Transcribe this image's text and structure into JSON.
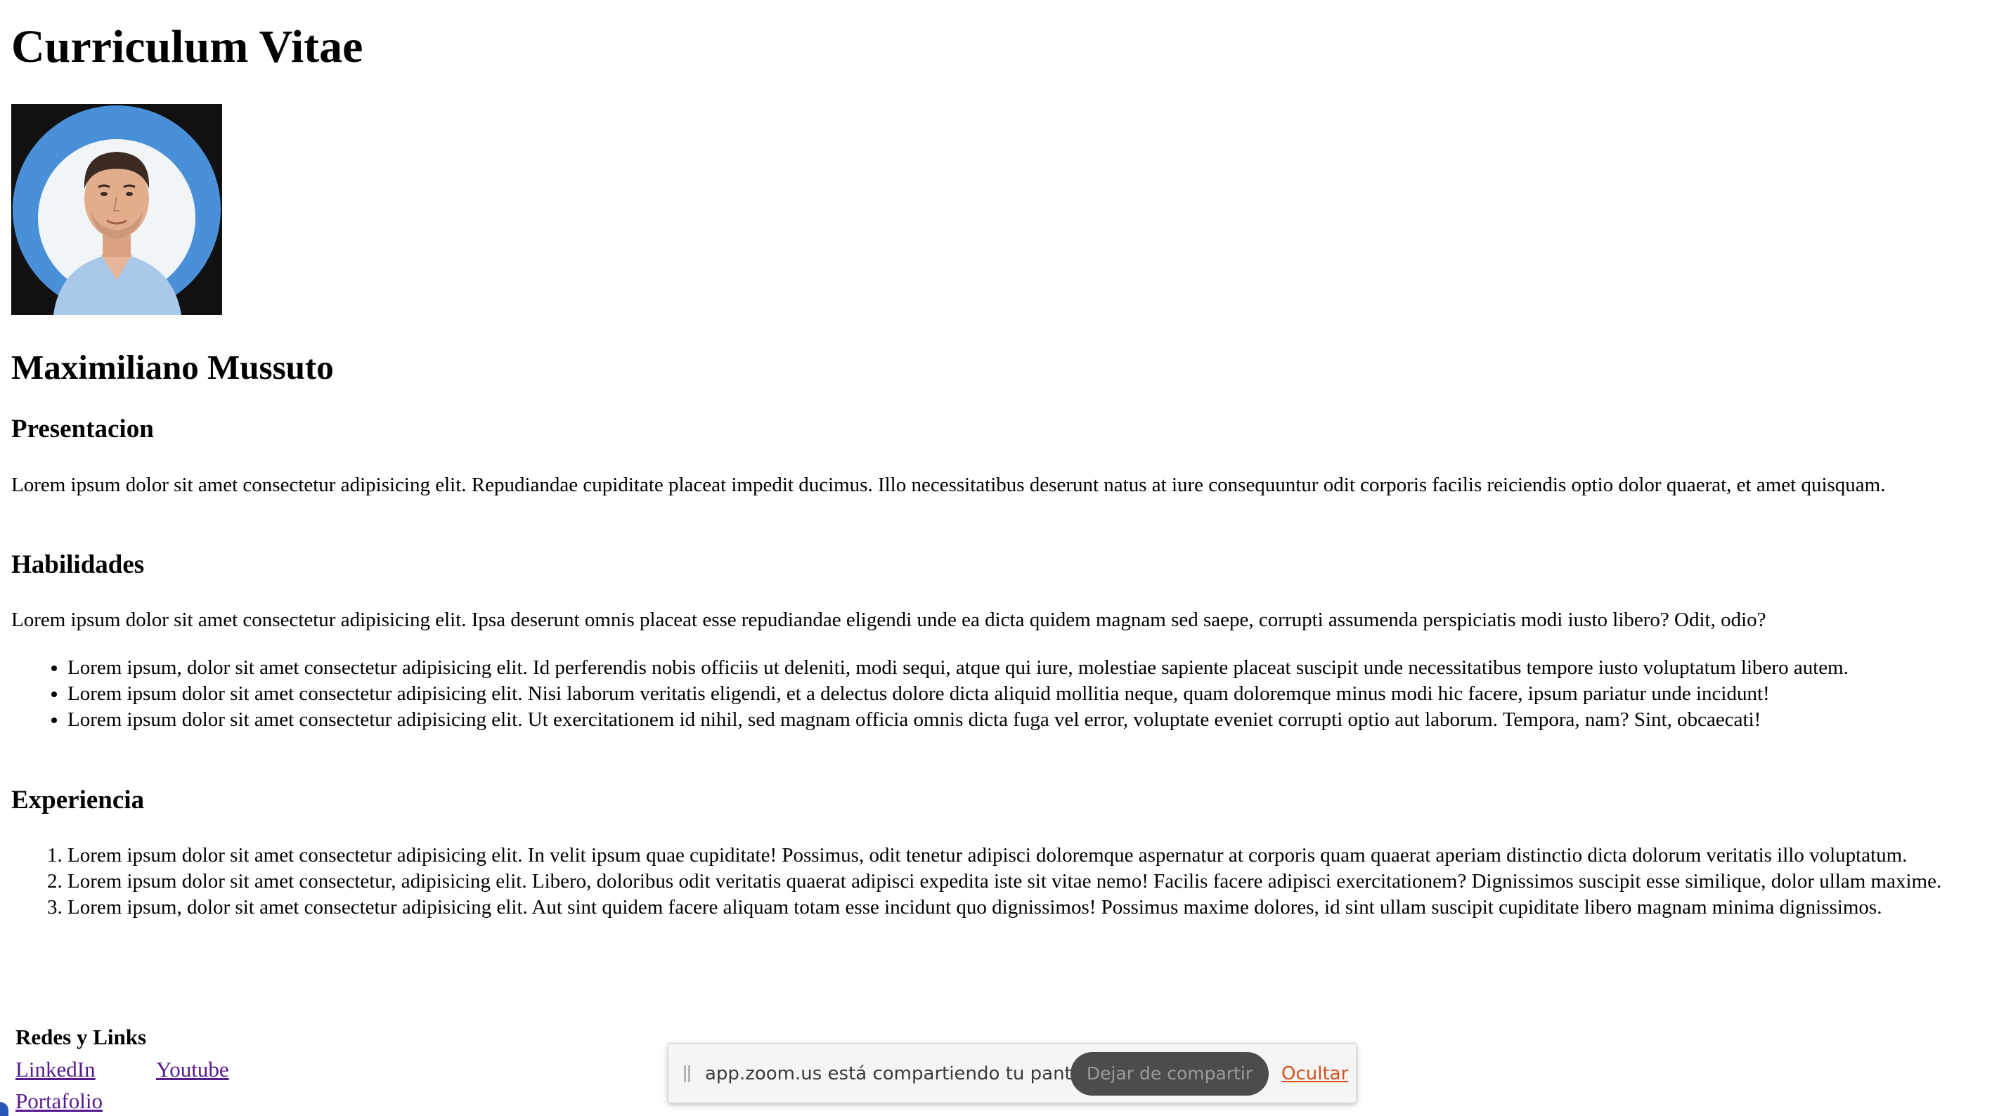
{
  "page": {
    "title": "Curriculum Vitae",
    "name": "Maximiliano Mussuto"
  },
  "sections": {
    "presentacion": {
      "heading": "Presentacion",
      "text": "Lorem ipsum dolor sit amet consectetur adipisicing elit. Repudiandae cupiditate placeat impedit ducimus. Illo necessitatibus deserunt natus at iure consequuntur odit corporis facilis reiciendis optio dolor quaerat, et amet quisquam."
    },
    "habilidades": {
      "heading": "Habilidades",
      "text": "Lorem ipsum dolor sit amet consectetur adipisicing elit. Ipsa deserunt omnis placeat esse repudiandae eligendi unde ea dicta quidem magnam sed saepe, corrupti assumenda perspiciatis modi iusto libero? Odit, odio?",
      "items": [
        "Lorem ipsum, dolor sit amet consectetur adipisicing elit. Id perferendis nobis officiis ut deleniti, modi sequi, atque qui iure, molestiae sapiente placeat suscipit unde necessitatibus tempore iusto voluptatum libero autem.",
        "Lorem ipsum dolor sit amet consectetur adipisicing elit. Nisi laborum veritatis eligendi, et a delectus dolore dicta aliquid mollitia neque, quam doloremque minus modi hic facere, ipsum pariatur unde incidunt!",
        "Lorem ipsum dolor sit amet consectetur adipisicing elit. Ut exercitationem id nihil, sed magnam officia omnis dicta fuga vel error, voluptate eveniet corrupti optio aut laborum. Tempora, nam? Sint, obcaecati!"
      ]
    },
    "experiencia": {
      "heading": "Experiencia",
      "items": [
        "Lorem ipsum dolor sit amet consectetur adipisicing elit. In velit ipsum quae cupiditate! Possimus, odit tenetur adipisci doloremque aspernatur at corporis quam quaerat aperiam distinctio dicta dolorum veritatis illo voluptatum.",
        "Lorem ipsum dolor sit amet consectetur, adipisicing elit. Libero, doloribus odit veritatis quaerat adipisci expedita iste sit vitae nemo! Facilis facere adipisci exercitationem? Dignissimos suscipit esse similique, dolor ullam maxime.",
        "Lorem ipsum, dolor sit amet consectetur adipisicing elit. Aut sint quidem facere aliquam totam esse incidunt quo dignissimos! Possimus maxime dolores, id sint ullam suscipit cupiditate libero magnam minima dignissimos."
      ]
    }
  },
  "links": {
    "heading": "Redes y Links",
    "linkedin": "LinkedIn",
    "youtube": "Youtube",
    "portfolio": "Portafolio"
  },
  "zoom_bar": {
    "message": "app.zoom.us está compartiendo tu pantalla.",
    "stop_label": "Dejar de compartir",
    "hide_label": "Ocultar"
  },
  "colors": {
    "link_visited": "#551a8b",
    "photo_background": "#4a90d9",
    "zoom_hide": "#d9501f",
    "zoom_button": "#4c4c4c"
  },
  "icons": {
    "profile_photo": "avatar-photo",
    "drag_handle": "grip-icon"
  }
}
